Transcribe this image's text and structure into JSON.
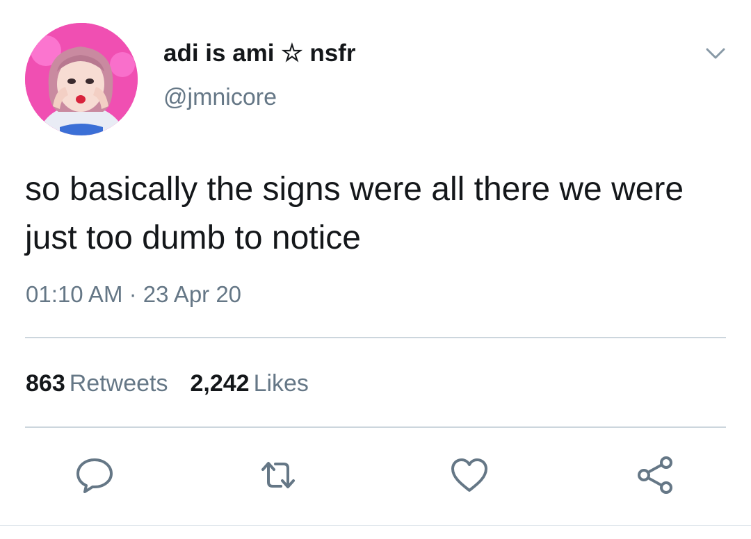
{
  "tweet": {
    "author": {
      "display_name": "adi is ami ☆ nsfr",
      "handle": "@jmnicore"
    },
    "text": "so basically the signs were all there we were just too dumb to notice",
    "timestamp": "01:10 AM · 23 Apr 20",
    "stats": {
      "retweets_count": "863",
      "retweets_label": "Retweets",
      "likes_count": "2,242",
      "likes_label": "Likes"
    }
  },
  "icons": {
    "menu": "chevron-down-icon",
    "reply": "reply-icon",
    "retweet": "retweet-icon",
    "like": "heart-icon",
    "share": "share-icon"
  },
  "colors": {
    "text": "#14171a",
    "secondary": "#657786",
    "divider": "#ccd6dd",
    "avatar_bg": "#f24fb3"
  }
}
